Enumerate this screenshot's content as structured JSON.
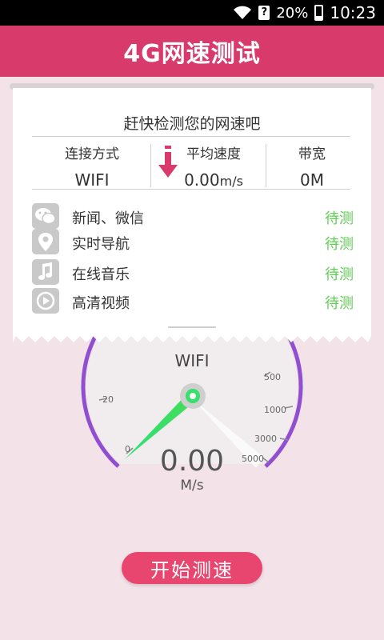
{
  "status_bar": {
    "battery_text": "20%",
    "time": "10:23",
    "signal_badge": "?"
  },
  "app_bar": {
    "title": "4G网速测试"
  },
  "card": {
    "title": "赶快检测您的网速吧",
    "stats": {
      "connection": {
        "label": "连接方式",
        "value": "WIFI"
      },
      "average_speed": {
        "label": "平均速度",
        "value": "0.00",
        "unit": "m/s"
      },
      "bandwidth": {
        "label": "带宽",
        "value": "0M"
      }
    },
    "items": [
      {
        "name": "新闻、微信",
        "icon": "wechat-icon",
        "status": "待测"
      },
      {
        "name": "实时导航",
        "icon": "location-pin-icon",
        "status": "待测"
      },
      {
        "name": "在线音乐",
        "icon": "music-note-icon",
        "status": "待测"
      },
      {
        "name": "高清视频",
        "icon": "play-circle-icon",
        "status": "待测"
      }
    ]
  },
  "gauge": {
    "network_label": "WIFI",
    "speed_value": "0.00",
    "speed_unit": "M/s",
    "ticks": [
      "0",
      "20",
      "500",
      "1000",
      "3000",
      "5000"
    ]
  },
  "start_button": {
    "label": "开始测速"
  },
  "colors": {
    "brand": "#d83a6c",
    "arc": "#8f4fd0",
    "needle": "#36e06a",
    "status_pending": "#5fcf52"
  }
}
